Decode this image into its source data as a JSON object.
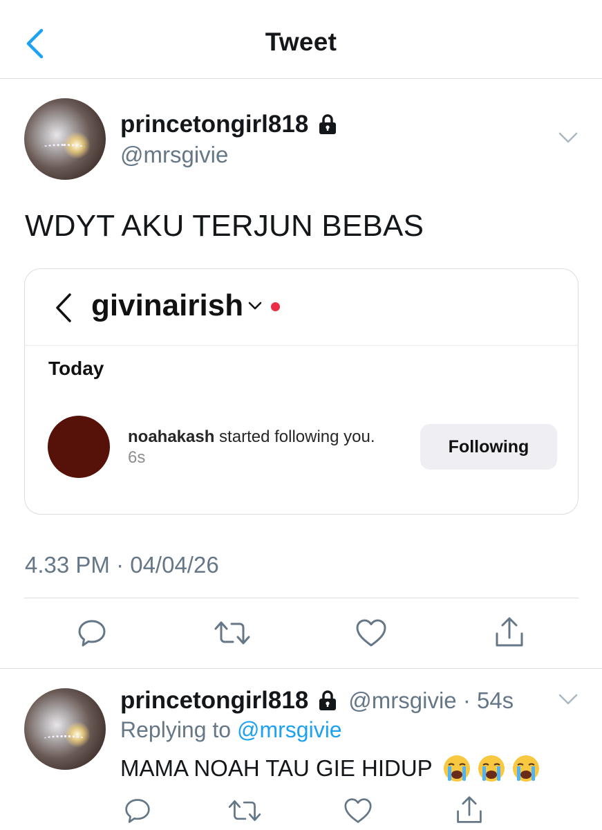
{
  "header": {
    "title": "Tweet",
    "back_icon": "chevron-left-icon",
    "accent_color": "#1da1f2"
  },
  "tweet": {
    "display_name": "princetongirl818",
    "handle": "@mrsgivie",
    "text": "WDYT AKU TERJUN BEBAS",
    "timestamp": "4.33 PM · 04/04/26",
    "embedded_screenshot": {
      "username": "givinairish",
      "section": "Today",
      "notification_user": "noahakash",
      "notification_text": " started following you. ",
      "notification_time": "6s",
      "button_label": "Following"
    },
    "actions": [
      "reply-icon",
      "retweet-icon",
      "like-icon",
      "share-icon"
    ]
  },
  "reply": {
    "display_name": "princetongirl818",
    "handle_time": "@mrsgivie · 54s",
    "replying_prefix": "Replying to ",
    "replying_to": "@mrsgivie",
    "text": "MAMA NOAH TAU GIE HIDUP",
    "emojis": [
      "loudly-crying-face",
      "loudly-crying-face",
      "loudly-crying-face"
    ]
  }
}
